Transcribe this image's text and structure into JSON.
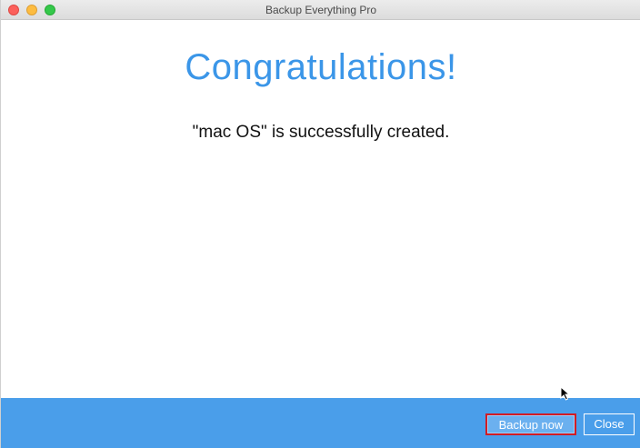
{
  "window": {
    "title": "Backup Everything Pro"
  },
  "main": {
    "heading": "Congratulations!",
    "message": "\"mac OS\" is successfully created."
  },
  "footer": {
    "backup_now_label": "Backup now",
    "close_label": "Close"
  },
  "colors": {
    "accent": "#3b96e8",
    "footer_bg": "#4a9eea",
    "highlight_border": "#d21c24"
  }
}
